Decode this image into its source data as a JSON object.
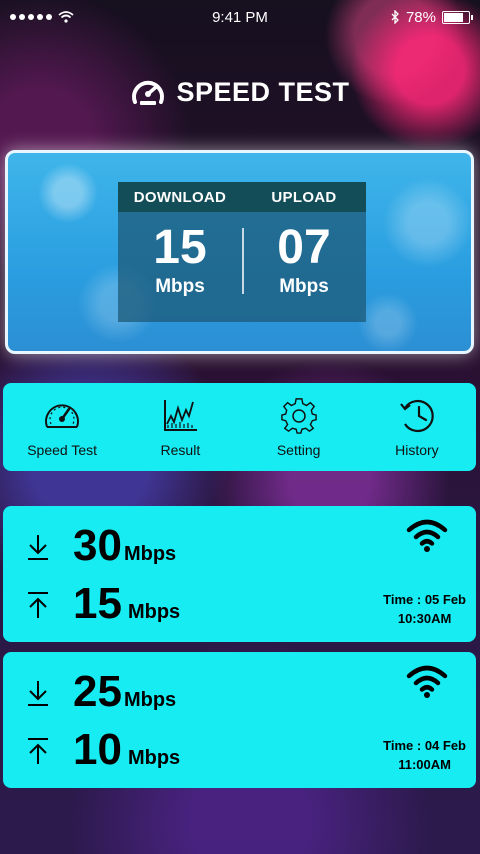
{
  "status_bar": {
    "time": "9:41 PM",
    "battery": "78%",
    "battery_level": 0.78
  },
  "header": {
    "title": "SPEED TEST",
    "logo_icon": "speedometer-icon"
  },
  "current_test": {
    "download_label": "DOWNLOAD",
    "upload_label": "UPLOAD",
    "download_value": "15",
    "upload_value": "07",
    "download_unit": "Mbps",
    "upload_unit": "Mbps"
  },
  "nav": {
    "items": [
      {
        "label": "Speed Test",
        "icon": "speedometer-icon"
      },
      {
        "label": "Result",
        "icon": "chart-icon"
      },
      {
        "label": "Setting",
        "icon": "gear-icon"
      },
      {
        "label": "History",
        "icon": "history-clock-icon"
      }
    ]
  },
  "history": [
    {
      "download": "30",
      "download_unit": "Mbps",
      "upload": "15",
      "upload_unit": "Mbps",
      "time_line1": "Time : 05 Feb",
      "time_line2": "10:30AM"
    },
    {
      "download": "25",
      "download_unit": "Mbps",
      "upload": "10",
      "upload_unit": "Mbps",
      "time_line1": "Time : 04 Feb",
      "time_line2": "11:00AM"
    }
  ],
  "colors": {
    "card": "#16ecf2",
    "panel": "#2a9ee0",
    "header_strip": "#134d57"
  }
}
